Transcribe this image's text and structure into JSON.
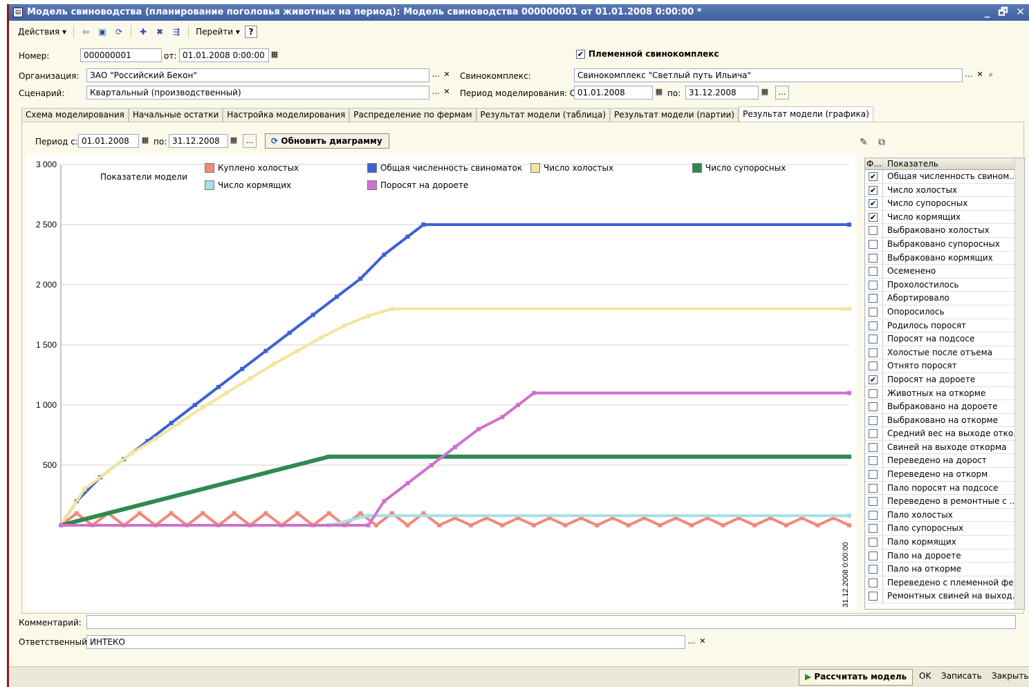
{
  "window": {
    "title": "Модель свиноводства (планирование поголовья животных на период): Модель свиноводства 000000001 от 01.01.2008 0:00:00 *",
    "controls": [
      "_",
      "🗗",
      "✕"
    ]
  },
  "toolbar": {
    "actions_label": "Действия",
    "goto_label": "Перейти",
    "help_label": "?"
  },
  "header": {
    "number_label": "Номер:",
    "number_value": "000000001",
    "from_label": "от:",
    "date_value": "01.01.2008  0:00:00",
    "breeding_checkbox_label": "Племенной свинокомплекс",
    "breeding_checked": "✔",
    "org_label": "Организация:",
    "org_value": "ЗАО \"Российский Бекон\"",
    "complex_label": "Свинокомплекс:",
    "complex_value": "Свинокомплекс \"Светлый путь Ильича\"",
    "scenario_label": "Сценарий:",
    "scenario_value": "Квартальный (производственный)",
    "period_label": "Период моделирования: С",
    "period_from": "01.01.2008",
    "period_to_label": "по:",
    "period_to": "31.12.2008"
  },
  "tabs": [
    "Схема моделирования",
    "Начальные остатки",
    "Настройка моделирования",
    "Распределение по фермам",
    "Результат модели (таблица)",
    "Результат модели (партии)",
    "Результат модели (графика)"
  ],
  "chart_panel": {
    "period_label": "Период с:",
    "period_from": "01.01.2008",
    "period_to_label": "по:",
    "period_to": "31.12.2008",
    "refresh_button": "Обновить диаграмму",
    "ellipsis": "..."
  },
  "chart_data": {
    "type": "line",
    "legend_title": "Показатели модели",
    "x_end_label": "31.12.2008 0:00:00",
    "ylim": [
      0,
      3000
    ],
    "yticks": [
      "3 000",
      "2 500",
      "2 000",
      "1 500",
      "1 000",
      "500"
    ],
    "ytick_values": [
      3000,
      2500,
      2000,
      1500,
      1000,
      500
    ],
    "series": [
      {
        "name": "Куплено холостых",
        "color": "#f08a78",
        "points": [
          [
            0,
            0
          ],
          [
            0.02,
            100
          ],
          [
            0.04,
            0
          ],
          [
            0.06,
            100
          ],
          [
            0.08,
            0
          ],
          [
            0.1,
            100
          ],
          [
            0.12,
            0
          ],
          [
            0.14,
            100
          ],
          [
            0.16,
            0
          ],
          [
            0.18,
            100
          ],
          [
            0.2,
            0
          ],
          [
            0.22,
            100
          ],
          [
            0.24,
            0
          ],
          [
            0.26,
            100
          ],
          [
            0.28,
            0
          ],
          [
            0.3,
            100
          ],
          [
            0.32,
            0
          ],
          [
            0.34,
            100
          ],
          [
            0.36,
            0
          ],
          [
            0.38,
            100
          ],
          [
            0.4,
            0
          ],
          [
            0.42,
            100
          ],
          [
            0.44,
            0
          ],
          [
            0.46,
            100
          ],
          [
            0.48,
            0
          ],
          [
            0.5,
            60
          ],
          [
            0.52,
            0
          ],
          [
            0.54,
            60
          ],
          [
            0.56,
            0
          ],
          [
            0.58,
            60
          ],
          [
            0.6,
            0
          ],
          [
            0.62,
            60
          ],
          [
            0.64,
            0
          ],
          [
            0.66,
            60
          ],
          [
            0.68,
            0
          ],
          [
            0.7,
            60
          ],
          [
            0.72,
            0
          ],
          [
            0.74,
            60
          ],
          [
            0.76,
            0
          ],
          [
            0.78,
            60
          ],
          [
            0.8,
            0
          ],
          [
            0.82,
            60
          ],
          [
            0.84,
            0
          ],
          [
            0.86,
            60
          ],
          [
            0.88,
            0
          ],
          [
            0.9,
            60
          ],
          [
            0.92,
            0
          ],
          [
            0.94,
            60
          ],
          [
            0.96,
            0
          ],
          [
            0.98,
            60
          ],
          [
            1,
            0
          ]
        ]
      },
      {
        "name": "Общая численность свиноматок",
        "color": "#3d62d6",
        "points": [
          [
            0,
            0
          ],
          [
            0.02,
            200
          ],
          [
            0.05,
            400
          ],
          [
            0.08,
            550
          ],
          [
            0.11,
            700
          ],
          [
            0.14,
            850
          ],
          [
            0.17,
            1000
          ],
          [
            0.2,
            1150
          ],
          [
            0.23,
            1300
          ],
          [
            0.26,
            1450
          ],
          [
            0.29,
            1600
          ],
          [
            0.32,
            1750
          ],
          [
            0.35,
            1900
          ],
          [
            0.38,
            2050
          ],
          [
            0.41,
            2250
          ],
          [
            0.44,
            2400
          ],
          [
            0.46,
            2500
          ],
          [
            1,
            2500
          ]
        ]
      },
      {
        "name": "Число холостых",
        "color": "#f2e49a",
        "points": [
          [
            0,
            0
          ],
          [
            0.03,
            300
          ],
          [
            0.06,
            450
          ],
          [
            0.09,
            600
          ],
          [
            0.12,
            720
          ],
          [
            0.15,
            850
          ],
          [
            0.18,
            980
          ],
          [
            0.21,
            1100
          ],
          [
            0.24,
            1220
          ],
          [
            0.27,
            1340
          ],
          [
            0.3,
            1450
          ],
          [
            0.33,
            1560
          ],
          [
            0.36,
            1660
          ],
          [
            0.39,
            1740
          ],
          [
            0.42,
            1800
          ],
          [
            1,
            1800
          ]
        ]
      },
      {
        "name": "Число супоросных",
        "color": "#2e8a4e",
        "points": [
          [
            0,
            0
          ],
          [
            0.34,
            570
          ],
          [
            1,
            570
          ]
        ]
      },
      {
        "name": "Число кормящих",
        "color": "#a4e0e6",
        "points": [
          [
            0,
            0
          ],
          [
            0.34,
            0
          ],
          [
            0.39,
            80
          ],
          [
            1,
            80
          ]
        ]
      },
      {
        "name": "Поросят на дороете",
        "color": "#d070d0",
        "points": [
          [
            0,
            0
          ],
          [
            0.39,
            0
          ],
          [
            0.41,
            200
          ],
          [
            0.44,
            350
          ],
          [
            0.47,
            500
          ],
          [
            0.5,
            650
          ],
          [
            0.53,
            800
          ],
          [
            0.56,
            900
          ],
          [
            0.58,
            1000
          ],
          [
            0.6,
            1100
          ],
          [
            1,
            1100
          ]
        ]
      }
    ]
  },
  "indicators": {
    "head_col1": "Ф...",
    "head_col2": "Показатель",
    "rows": [
      {
        "label": "Общая численность свином...",
        "checked": "✔"
      },
      {
        "label": "Число холостых",
        "checked": "✔"
      },
      {
        "label": "Число супоросных",
        "checked": "✔"
      },
      {
        "label": "Число кормящих",
        "checked": "✔"
      },
      {
        "label": "Выбраковано холостых",
        "checked": ""
      },
      {
        "label": "Выбраковано супоросных",
        "checked": ""
      },
      {
        "label": "Выбраковано кормящих",
        "checked": ""
      },
      {
        "label": "Осеменено",
        "checked": ""
      },
      {
        "label": "Прохолостилось",
        "checked": ""
      },
      {
        "label": "Абортировало",
        "checked": ""
      },
      {
        "label": "Опоросилось",
        "checked": ""
      },
      {
        "label": "Родилось поросят",
        "checked": ""
      },
      {
        "label": "Поросят на подсосе",
        "checked": ""
      },
      {
        "label": "Холостые после отъема",
        "checked": ""
      },
      {
        "label": "Отнято поросят",
        "checked": ""
      },
      {
        "label": "Поросят на дороете",
        "checked": "✔"
      },
      {
        "label": "Животных на откорме",
        "checked": ""
      },
      {
        "label": "Выбраковано на дороете",
        "checked": ""
      },
      {
        "label": "Выбраковано на откорме",
        "checked": ""
      },
      {
        "label": "Средний вес на выходе отко...",
        "checked": ""
      },
      {
        "label": "Свиней на выходе откорма",
        "checked": ""
      },
      {
        "label": "Переведено на дорост",
        "checked": ""
      },
      {
        "label": "Переведено на откорм",
        "checked": ""
      },
      {
        "label": "Пало поросят на подсосе",
        "checked": ""
      },
      {
        "label": "Переведено в ремонтные с ...",
        "checked": ""
      },
      {
        "label": "Пало холостых",
        "checked": ""
      },
      {
        "label": "Пало супоросных",
        "checked": ""
      },
      {
        "label": "Пало кормящих",
        "checked": ""
      },
      {
        "label": "Пало на дороете",
        "checked": ""
      },
      {
        "label": "Пало на откорме",
        "checked": ""
      },
      {
        "label": "Переведено с племенной фе...",
        "checked": ""
      },
      {
        "label": "Ремонтных свиней на выход...",
        "checked": ""
      }
    ]
  },
  "footer": {
    "comment_label": "Комментарий:",
    "comment_value": "",
    "responsible_label": "Ответственный:",
    "responsible_value": "ИНТЕКО",
    "calc_button": "Рассчитать модель",
    "ok_button": "OK",
    "save_button": "Записать",
    "close_button": "Закрыть"
  }
}
